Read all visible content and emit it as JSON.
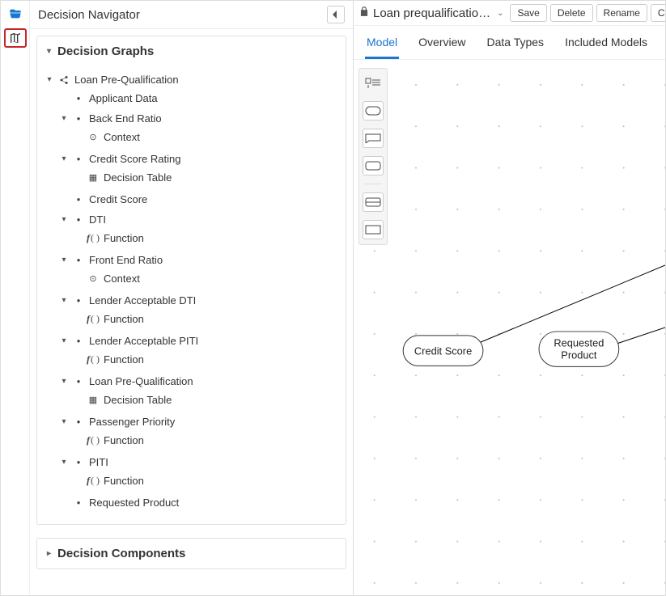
{
  "rail": {
    "folder_icon": "folder-open",
    "map_icon": "map"
  },
  "sidebar": {
    "title": "Decision Navigator",
    "panel_graphs": "Decision Graphs",
    "panel_components": "Decision Components",
    "tree": {
      "root": "Loan Pre-Qualification",
      "items": [
        {
          "label": "Applicant Data",
          "icon": "dot",
          "children": []
        },
        {
          "label": "Back End Ratio",
          "icon": "dot",
          "children": [
            {
              "label": "Context",
              "icon": "ctx"
            }
          ]
        },
        {
          "label": "Credit Score Rating",
          "icon": "dot",
          "children": [
            {
              "label": "Decision Table",
              "icon": "table"
            }
          ]
        },
        {
          "label": "Credit Score",
          "icon": "dot",
          "children": []
        },
        {
          "label": "DTI",
          "icon": "dot",
          "children": [
            {
              "label": "Function",
              "icon": "fn"
            }
          ]
        },
        {
          "label": "Front End Ratio",
          "icon": "dot",
          "children": [
            {
              "label": "Context",
              "icon": "ctx"
            }
          ]
        },
        {
          "label": "Lender Acceptable DTI",
          "icon": "dot",
          "children": [
            {
              "label": "Function",
              "icon": "fn"
            }
          ]
        },
        {
          "label": "Lender Acceptable PITI",
          "icon": "dot",
          "children": [
            {
              "label": "Function",
              "icon": "fn"
            }
          ]
        },
        {
          "label": "Loan Pre-Qualification",
          "icon": "dot",
          "children": [
            {
              "label": "Decision Table",
              "icon": "table"
            }
          ]
        },
        {
          "label": "Passenger Priority",
          "icon": "dot",
          "children": [
            {
              "label": "Function",
              "icon": "fn"
            }
          ]
        },
        {
          "label": "PITI",
          "icon": "dot",
          "children": [
            {
              "label": "Function",
              "icon": "fn"
            }
          ]
        },
        {
          "label": "Requested Product",
          "icon": "dot",
          "children": []
        }
      ]
    }
  },
  "editor": {
    "lock": "🔒",
    "filename": "Loan prequalificatio…",
    "actions": [
      "Save",
      "Delete",
      "Rename",
      "Co"
    ],
    "tabs": [
      "Model",
      "Overview",
      "Data Types",
      "Included Models"
    ],
    "active_tab": 0,
    "nodes": {
      "credit_score": "Credit Score",
      "requested_product_line1": "Requested",
      "requested_product_line2": "Product"
    }
  }
}
